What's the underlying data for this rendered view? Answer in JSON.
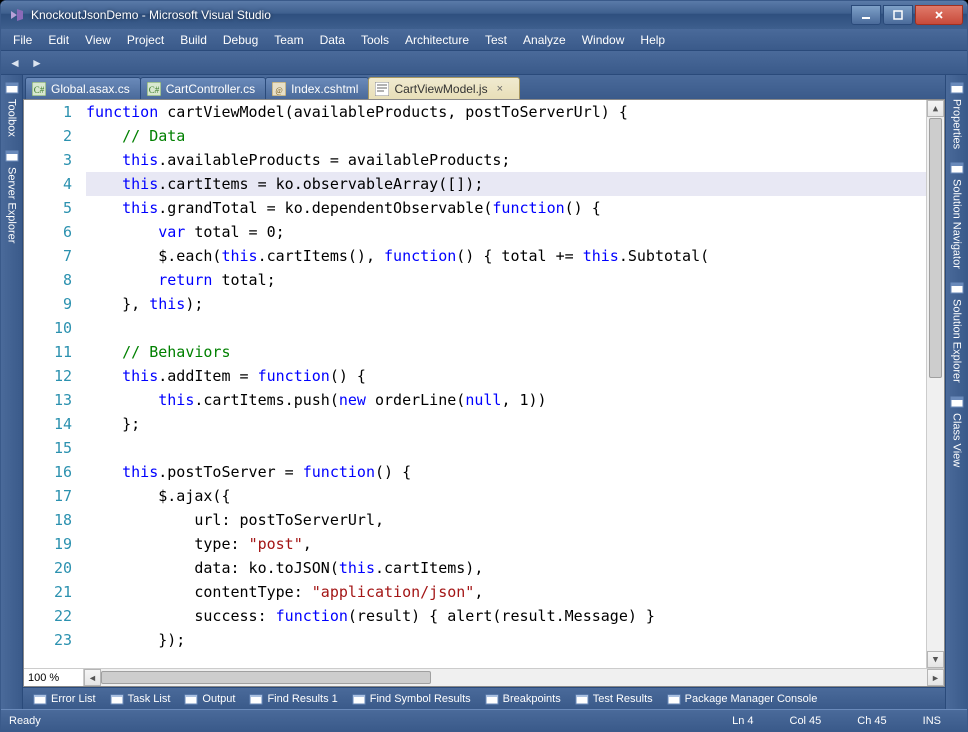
{
  "title": "KnockoutJsonDemo - Microsoft Visual Studio",
  "menus": [
    "File",
    "Edit",
    "View",
    "Project",
    "Build",
    "Debug",
    "Team",
    "Data",
    "Tools",
    "Architecture",
    "Test",
    "Analyze",
    "Window",
    "Help"
  ],
  "left_panels": [
    {
      "name": "Toolbox",
      "icon": "toolbox"
    },
    {
      "name": "Server Explorer",
      "icon": "server"
    }
  ],
  "right_panels": [
    {
      "name": "Properties",
      "icon": "properties"
    },
    {
      "name": "Solution Navigator",
      "icon": "sln-nav"
    },
    {
      "name": "Solution Explorer",
      "icon": "sln-exp"
    },
    {
      "name": "Class View",
      "icon": "class-view"
    }
  ],
  "tabs": [
    {
      "label": "Global.asax.cs",
      "icon": "cs",
      "active": false
    },
    {
      "label": "CartController.cs",
      "icon": "cs",
      "active": false
    },
    {
      "label": "Index.cshtml",
      "icon": "cshtml",
      "active": false
    },
    {
      "label": "CartViewModel.js",
      "icon": "js",
      "active": true
    }
  ],
  "zoom": "100 %",
  "bottom_tools": [
    "Error List",
    "Task List",
    "Output",
    "Find Results 1",
    "Find Symbol Results",
    "Breakpoints",
    "Test Results",
    "Package Manager Console"
  ],
  "status": {
    "ready": "Ready",
    "ln": "Ln 4",
    "col": "Col 45",
    "ch": "Ch 45",
    "ins": "INS"
  },
  "highlight_line": 4,
  "code": [
    [
      [
        "kw",
        "function"
      ],
      [
        "",
        " cartViewModel(availableProducts, postToServerUrl) {"
      ]
    ],
    [
      [
        "",
        "    "
      ],
      [
        "com",
        "// Data"
      ]
    ],
    [
      [
        "",
        "    "
      ],
      [
        "kw",
        "this"
      ],
      [
        "",
        ".availableProducts = availableProducts;"
      ]
    ],
    [
      [
        "",
        "    "
      ],
      [
        "kw",
        "this"
      ],
      [
        "",
        ".cartItems = ko.observableArray([]);"
      ]
    ],
    [
      [
        "",
        "    "
      ],
      [
        "kw",
        "this"
      ],
      [
        "",
        ".grandTotal = ko.dependentObservable("
      ],
      [
        "kw",
        "function"
      ],
      [
        "",
        "() {"
      ]
    ],
    [
      [
        "",
        "        "
      ],
      [
        "kw",
        "var"
      ],
      [
        "",
        " total = 0;"
      ]
    ],
    [
      [
        "",
        "        $.each("
      ],
      [
        "kw",
        "this"
      ],
      [
        "",
        ".cartItems(), "
      ],
      [
        "kw",
        "function"
      ],
      [
        "",
        "() { total += "
      ],
      [
        "kw",
        "this"
      ],
      [
        "",
        ".Subtotal("
      ]
    ],
    [
      [
        "",
        "        "
      ],
      [
        "kw",
        "return"
      ],
      [
        "",
        " total;"
      ]
    ],
    [
      [
        "",
        "    }, "
      ],
      [
        "kw",
        "this"
      ],
      [
        "",
        ");"
      ]
    ],
    [
      [
        "",
        ""
      ]
    ],
    [
      [
        "",
        "    "
      ],
      [
        "com",
        "// Behaviors"
      ]
    ],
    [
      [
        "",
        "    "
      ],
      [
        "kw",
        "this"
      ],
      [
        "",
        ".addItem = "
      ],
      [
        "kw",
        "function"
      ],
      [
        "",
        "() {"
      ]
    ],
    [
      [
        "",
        "        "
      ],
      [
        "kw",
        "this"
      ],
      [
        "",
        ".cartItems.push("
      ],
      [
        "kw",
        "new"
      ],
      [
        "",
        " orderLine("
      ],
      [
        "kw",
        "null"
      ],
      [
        "",
        ", 1))"
      ]
    ],
    [
      [
        "",
        "    };"
      ]
    ],
    [
      [
        "",
        ""
      ]
    ],
    [
      [
        "",
        "    "
      ],
      [
        "kw",
        "this"
      ],
      [
        "",
        ".postToServer = "
      ],
      [
        "kw",
        "function"
      ],
      [
        "",
        "() {"
      ]
    ],
    [
      [
        "",
        "        $.ajax({"
      ]
    ],
    [
      [
        "",
        "            url: postToServerUrl,"
      ]
    ],
    [
      [
        "",
        "            type: "
      ],
      [
        "str",
        "\"post\""
      ],
      [
        "",
        ","
      ]
    ],
    [
      [
        "",
        "            data: ko.toJSON("
      ],
      [
        "kw",
        "this"
      ],
      [
        "",
        ".cartItems),"
      ]
    ],
    [
      [
        "",
        "            contentType: "
      ],
      [
        "str",
        "\"application/json\""
      ],
      [
        "",
        ","
      ]
    ],
    [
      [
        "",
        "            success: "
      ],
      [
        "kw",
        "function"
      ],
      [
        "",
        "(result) { alert(result.Message) }"
      ]
    ],
    [
      [
        "",
        "        });"
      ]
    ]
  ]
}
